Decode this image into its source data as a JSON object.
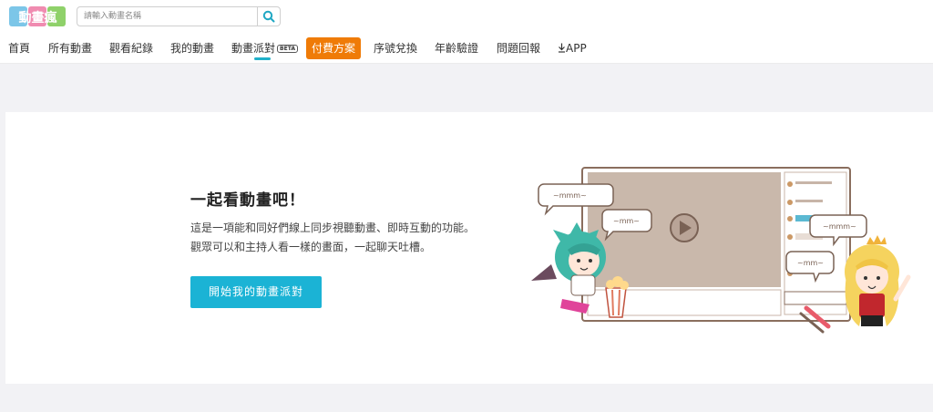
{
  "header": {
    "logo_text": "動畫瘋",
    "search": {
      "placeholder": "請輸入動畫名稱",
      "value": ""
    },
    "nav": [
      {
        "label": "首頁"
      },
      {
        "label": "所有動畫"
      },
      {
        "label": "觀看紀錄"
      },
      {
        "label": "我的動畫"
      },
      {
        "label": "動畫派對",
        "badge": "BETA",
        "active": true
      },
      {
        "label": "付費方案",
        "highlight": true
      },
      {
        "label": "序號兌換"
      },
      {
        "label": "年齡驗證"
      },
      {
        "label": "問題回報"
      },
      {
        "label": "APP",
        "icon": "download-icon"
      }
    ]
  },
  "main": {
    "title": "一起看動畫吧！",
    "description_line1": "這是一項能和同好們線上同步視聽動畫、即時互動的功能。",
    "description_line2": "觀眾可以和主持人看一樣的畫面，一起聊天吐槽。",
    "cta_label": "開始我的動畫派對",
    "bubble_texts": [
      "~mmm~",
      "~mm~",
      "~mmm~",
      "~mm~"
    ]
  },
  "colors": {
    "accent": "#1bb3d5",
    "nav_underline": "#1fb0c9",
    "paid_button": "#ef7b07",
    "page_bg": "#f2f2f5"
  }
}
